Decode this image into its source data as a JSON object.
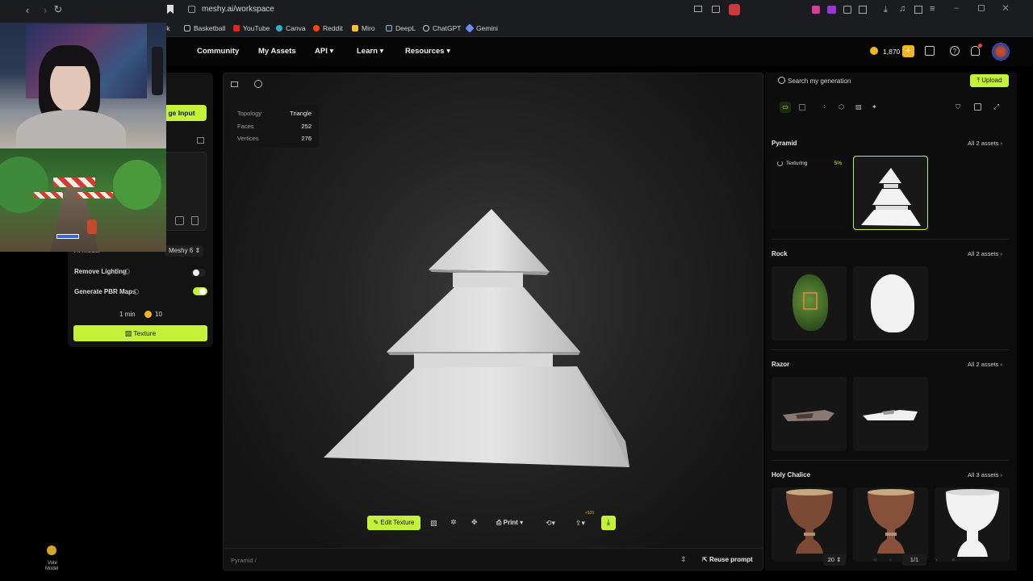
{
  "browser": {
    "url": "meshy.ai/workspace",
    "bookmarks": [
      "Basketball",
      "YouTube",
      "Canva",
      "Reddit",
      "Miro",
      "DeepL",
      "ChatGPT",
      "Gemini"
    ],
    "bookmark_partial": "ck"
  },
  "header": {
    "nav": [
      "Community",
      "My Assets",
      "API",
      "Learn",
      "Resources"
    ],
    "credits": "1,870"
  },
  "left_panel": {
    "image_input_btn": "ge Input",
    "ai_model_label": "AI Model",
    "ai_model_value": "Meshy 6",
    "remove_lighting": "Remove Lighting",
    "pbr_maps": "Generate PBR Maps",
    "time": "1 min",
    "cost": "10",
    "texture_btn": "Texture",
    "vote_label": "Vote",
    "model_label": "Model"
  },
  "viewport": {
    "stats": [
      {
        "label": "Topology",
        "value": "Triangle"
      },
      {
        "label": "Faces",
        "value": "252"
      },
      {
        "label": "Vertices",
        "value": "276"
      }
    ],
    "toolbar": {
      "edit_texture": "Edit Texture",
      "print": "Print",
      "badge": "+$20"
    },
    "breadcrumb": "Pyramid",
    "breadcrumb_sep": "/",
    "reuse_prompt": "Reuse prompt"
  },
  "right_panel": {
    "search_placeholder": "Search my generation",
    "upload": "Upload",
    "sections": [
      {
        "title": "Pyramid",
        "all": "All 2 assets"
      },
      {
        "title": "Rock",
        "all": "All 2 assets"
      },
      {
        "title": "Razor",
        "all": "All 2 assets"
      },
      {
        "title": "Holy Chalice",
        "all": "All 3 assets"
      }
    ],
    "texturing_label": "Texturing",
    "texturing_progress": "5%",
    "page_size": "20",
    "page": "1/1"
  },
  "colors": {
    "accent": "#c4f239",
    "bg": "#050505",
    "panel": "#131313"
  }
}
